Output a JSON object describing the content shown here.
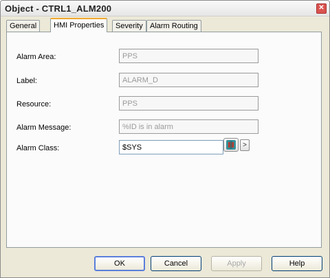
{
  "window": {
    "title": "Object - CTRL1_ALM200",
    "close_glyph": "✕"
  },
  "tabs": [
    {
      "label": "General",
      "active": false
    },
    {
      "label": "HMI Properties",
      "active": true
    },
    {
      "label": "Severity",
      "active": false
    },
    {
      "label": "Alarm Routing",
      "active": false
    }
  ],
  "fields": {
    "alarm_area": {
      "label": "Alarm Area:",
      "value": "PPS"
    },
    "label": {
      "label": "Label:",
      "value": "ALARM_D"
    },
    "resource": {
      "label": "Resource:",
      "value": "PPS"
    },
    "alarm_message": {
      "label": "Alarm Message:",
      "value": "%ID is in alarm"
    },
    "alarm_class": {
      "label": "Alarm Class:",
      "value": "$SYS"
    }
  },
  "browse_arrow": ">",
  "buttons": {
    "ok": "OK",
    "cancel": "Cancel",
    "apply": "Apply",
    "help": "Help"
  },
  "colors": {
    "active_tab_accent": "#f0a830",
    "close_button": "#d9534f",
    "default_button_border": "#5a7edc"
  },
  "icons": {
    "close": "close-icon",
    "class_picker": "alarm-class-picker-icon"
  }
}
